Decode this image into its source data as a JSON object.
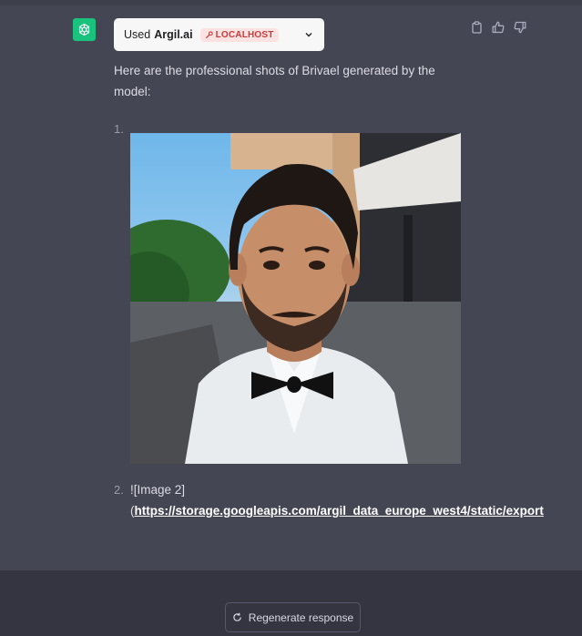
{
  "message": {
    "plugin_used_prefix": "Used",
    "plugin_name": "Argil.ai",
    "plugin_badge": "LOCALHOST",
    "intro_text": "Here are the professional shots of Brivael generated by the model:",
    "list": [
      {
        "number": "1."
      },
      {
        "number": "2.",
        "text": "![Image 2]",
        "open_paren": "(",
        "link_text": "https://storage.googleapis.com/argil_data_europe_west4/static/export"
      }
    ]
  },
  "actions": {
    "copy_icon": "clipboard-icon",
    "thumbs_up_icon": "thumbs-up-icon",
    "thumbs_down_icon": "thumbs-down-icon"
  },
  "footer": {
    "regenerate_label": "Regenerate response"
  },
  "colors": {
    "background": "#444654",
    "footer_background": "#343541",
    "avatar": "#19c37d",
    "badge_bg": "#fde2e2",
    "badge_text": "#c63b3b"
  }
}
